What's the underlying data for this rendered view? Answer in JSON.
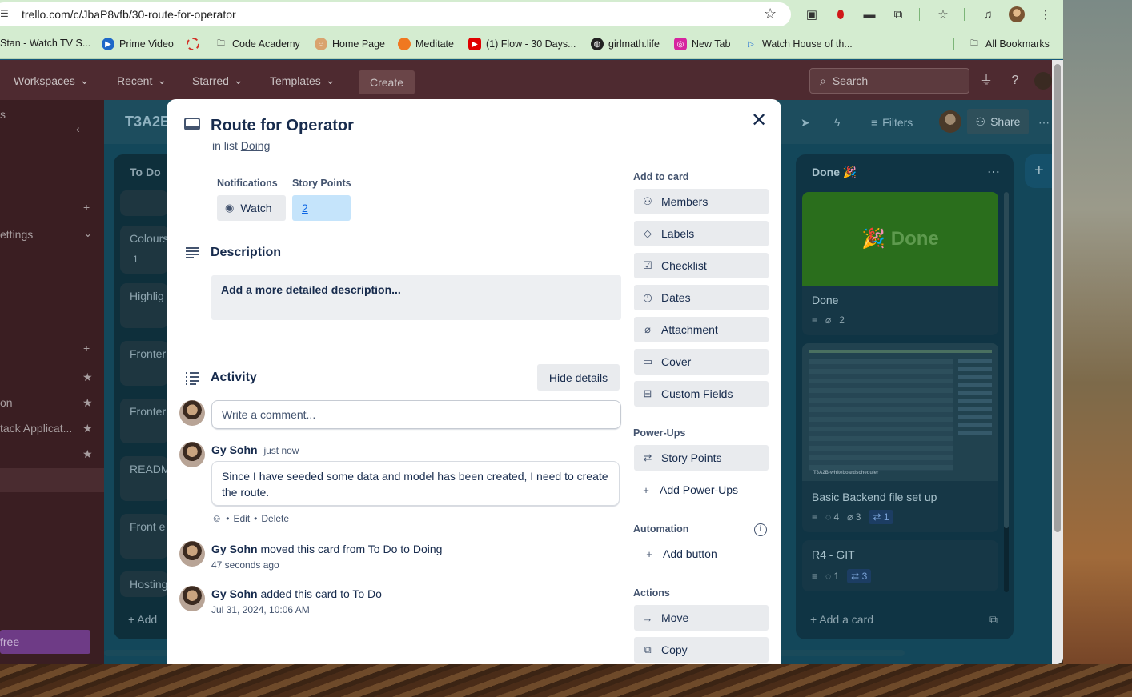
{
  "browser": {
    "url": "trello.com/c/JbaP8vfb/30-route-for-operator",
    "bookmarks": [
      {
        "label": "Stan - Watch TV S..."
      },
      {
        "label": "Prime Video"
      },
      {
        "label": ""
      },
      {
        "label": "Code Academy"
      },
      {
        "label": "Home Page"
      },
      {
        "label": "Meditate"
      },
      {
        "label": "(1) Flow - 30 Days..."
      },
      {
        "label": "girlmath.life"
      },
      {
        "label": "New Tab"
      },
      {
        "label": "Watch House of th..."
      }
    ],
    "all_bookmarks": "All Bookmarks"
  },
  "header": {
    "workspaces": "Workspaces",
    "recent": "Recent",
    "starred": "Starred",
    "templates": "Templates",
    "create": "Create",
    "search_placeholder": "Search"
  },
  "sidebar": {
    "item_s": "s",
    "settings": "ettings",
    "item_on": "on",
    "item_stack": "tack Applicat...",
    "try_free": "free"
  },
  "board": {
    "title": "T3A2E",
    "filters": "Filters",
    "share": "Share",
    "lists": {
      "todo": {
        "title": "To Do",
        "cards": [
          "Colours",
          "Highlig",
          "Fronter",
          "Fronter",
          "READM",
          "Front e",
          "Hosting"
        ],
        "add_card": "Add",
        "colours_comments": "1"
      },
      "done": {
        "title": "Done 🎉",
        "cover_text": "🎉 Done",
        "add_card": "Add a card",
        "cards": [
          {
            "title": "Done",
            "attachments": "2"
          },
          {
            "title": "Basic Backend file set up",
            "comments": "4",
            "attachments": "3",
            "powerup": "1",
            "image_caption": "T3A2B-whiteboardscheduler"
          },
          {
            "title": "R4 - GIT",
            "comments": "1",
            "powerup": "3"
          }
        ]
      }
    }
  },
  "modal": {
    "title": "Route for Operator",
    "in_list_prefix": "in list",
    "list_name": "Doing",
    "notifications_label": "Notifications",
    "watch_label": "Watch",
    "story_points_label": "Story Points",
    "story_points_value": "2",
    "description_title": "Description",
    "description_placeholder": "Add a more detailed description...",
    "activity_title": "Activity",
    "hide_details": "Hide details",
    "comment_placeholder": "Write a comment...",
    "activity": [
      {
        "user": "Gy Sohn",
        "time": "just now",
        "comment": "Since I have seeded some data and model has been created, I need to create the route."
      },
      {
        "user": "Gy Sohn",
        "text": "moved this card from To Do to Doing",
        "time": "47 seconds ago"
      },
      {
        "user": "Gy Sohn",
        "text": "added this card to To Do",
        "time": "Jul 31, 2024, 10:06 AM"
      }
    ],
    "comment_edit": "Edit",
    "comment_delete": "Delete",
    "add_to_card_label": "Add to card",
    "add_to_card": [
      "Members",
      "Labels",
      "Checklist",
      "Dates",
      "Attachment",
      "Cover",
      "Custom Fields"
    ],
    "power_ups_label": "Power-Ups",
    "story_points_button": "Story Points",
    "add_power_ups": "Add Power-Ups",
    "automation_label": "Automation",
    "add_button": "Add button",
    "actions_label": "Actions",
    "actions": [
      "Move",
      "Copy"
    ]
  }
}
